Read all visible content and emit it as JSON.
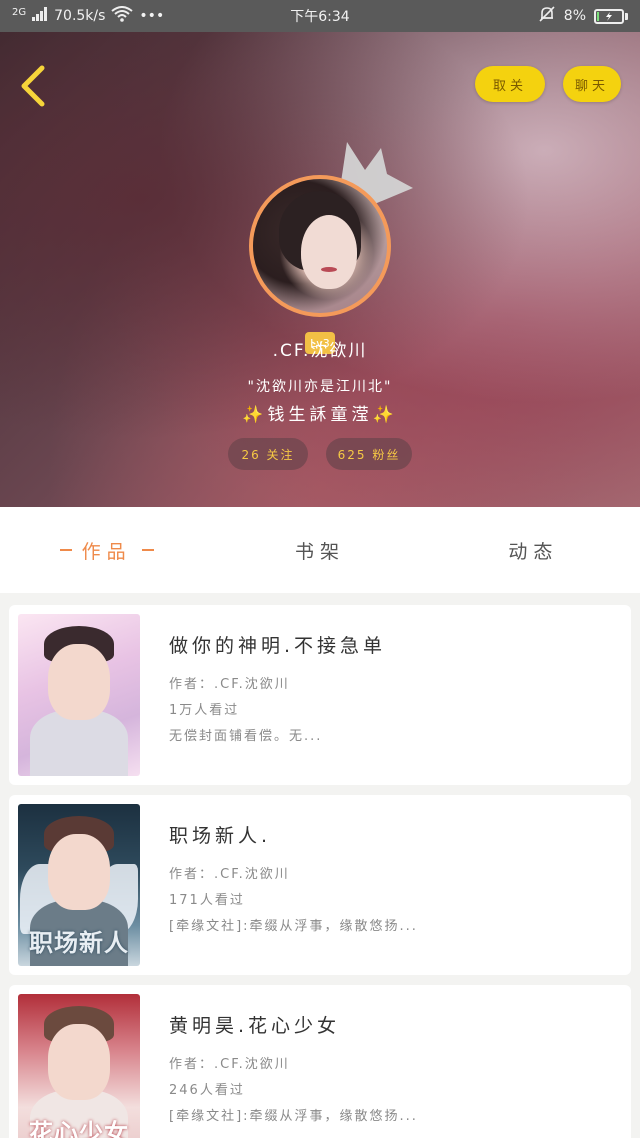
{
  "status_bar": {
    "network": "2G",
    "speed": "70.5k/s",
    "dots": "•••",
    "time": "下午6:34",
    "battery": "8%",
    "battery_level": 0.08
  },
  "header": {
    "follow_label": "取关",
    "chat_label": "聊天"
  },
  "profile": {
    "level": "Lv3",
    "username": ".CF.沈欲川",
    "quote": "\"沈欲川亦是江川北\"",
    "motto": "✨钱生訸童滢✨",
    "following": "26 关注",
    "fans": "625 粉丝"
  },
  "tabs": [
    {
      "label": "作品",
      "active": true
    },
    {
      "label": "书架",
      "active": false
    },
    {
      "label": "动态",
      "active": false
    }
  ],
  "books": [
    {
      "title": "做你的神明.不接急单",
      "author": "作者：.CF.沈欲川",
      "views": "1万人看过",
      "desc": "无偿封面铺看偿。无...",
      "cover_text": ""
    },
    {
      "title": "职场新人.",
      "author": "作者：.CF.沈欲川",
      "views": "171人看过",
      "desc": "[牵缘文社]:牵缀从浮事，缘散悠扬...",
      "cover_text": "职场新人"
    },
    {
      "title": "黄明昊.花心少女",
      "author": "作者：.CF.沈欲川",
      "views": "246人看过",
      "desc": "[牵缘文社]:牵缀从浮事，缘散悠扬...",
      "cover_text": "花心少女"
    }
  ]
}
